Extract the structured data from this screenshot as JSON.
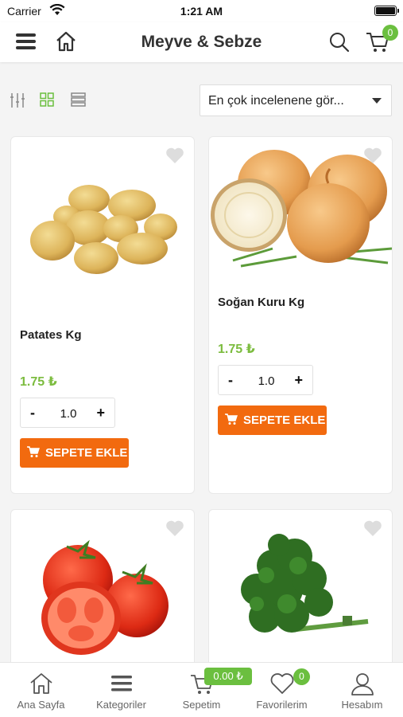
{
  "status_bar": {
    "carrier": "Carrier",
    "time": "1:21 AM"
  },
  "header": {
    "title": "Meyve & Sebze",
    "cart_count": "0"
  },
  "toolbar": {
    "sort_value": "En çok incelenene gör..."
  },
  "products": [
    {
      "name": "Patates Kg",
      "price": "1.75 ₺",
      "quantity": "1.0",
      "add_label": "SEPETE EKLE",
      "image": "potatoes"
    },
    {
      "name": "Soğan Kuru Kg",
      "price": "1.75 ₺",
      "quantity": "1.0",
      "add_label": "SEPETE EKLE",
      "image": "onions"
    },
    {
      "name": "",
      "image": "tomatoes"
    },
    {
      "name": "",
      "image": "parsley"
    }
  ],
  "tabbar": {
    "items": [
      {
        "label": "Ana Sayfa",
        "icon": "home-icon"
      },
      {
        "label": "Kategoriler",
        "icon": "menu-icon"
      },
      {
        "label": "Sepetim",
        "icon": "cart-icon"
      },
      {
        "label": "Favorilerim",
        "icon": "heart-icon"
      },
      {
        "label": "Hesabım",
        "icon": "user-icon"
      }
    ],
    "basket_total": "0.00 ₺",
    "favorites_count": "0"
  },
  "colors": {
    "accent_green": "#6bbf3f",
    "price_green": "#7cbc3f",
    "button_orange": "#f26a0f"
  }
}
